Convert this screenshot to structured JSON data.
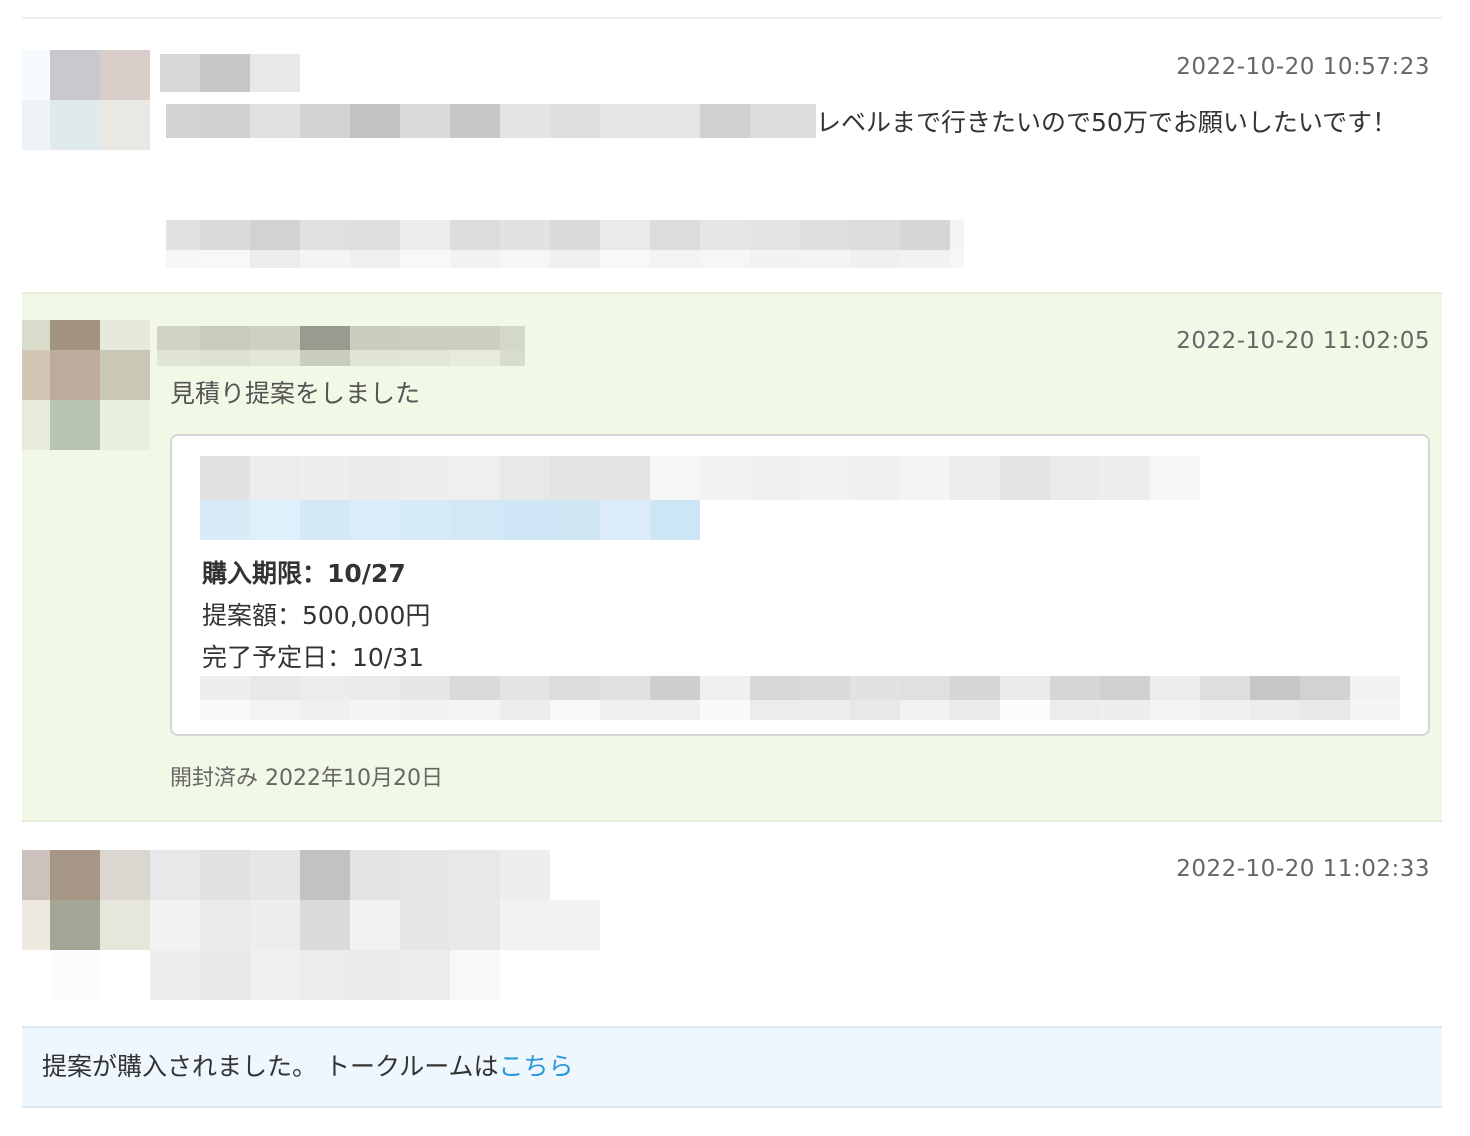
{
  "messages": [
    {
      "timestamp": "2022-10-20 10:57:23",
      "text_after_redaction": "レベルまで行きたいので50万でお願いしたいです！"
    },
    {
      "timestamp": "2022-10-20 11:02:05",
      "proposal_title": "見積り提案をしました",
      "proposal": {
        "deadline": "購入期限：10/27",
        "amount": "提案額：500,000円",
        "completion_date": "完了予定日：10/31"
      },
      "opened_status": "開封済み 2022年10月20日"
    },
    {
      "timestamp": "2022-10-20 11:02:33"
    }
  ],
  "notice": {
    "text": "提案が購入されました。 トークルームは",
    "link_label": "こちら"
  },
  "colors": {
    "proposal_background": "#f1f8e6",
    "notice_background": "#eef7fd",
    "link": "#2a98d8",
    "timestamp": "#666666"
  }
}
